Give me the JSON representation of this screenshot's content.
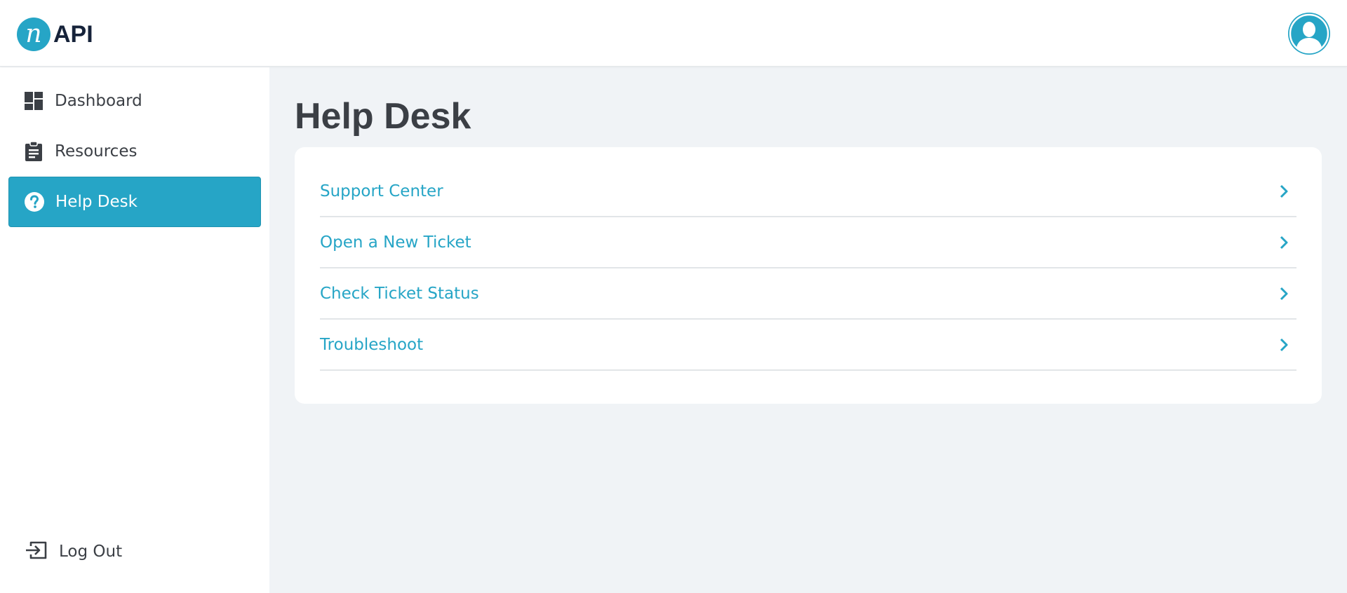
{
  "header": {
    "logo_mark": "n",
    "logo_text": "API",
    "avatar_icon": "user-avatar-icon"
  },
  "sidebar": {
    "items": [
      {
        "label": "Dashboard",
        "icon": "dashboard-icon",
        "active": false
      },
      {
        "label": "Resources",
        "icon": "clipboard-icon",
        "active": false
      },
      {
        "label": "Help Desk",
        "icon": "help-circle-icon",
        "active": true
      }
    ],
    "logout": {
      "label": "Log Out",
      "icon": "logout-icon"
    }
  },
  "main": {
    "title": "Help Desk",
    "links": [
      {
        "label": "Support Center"
      },
      {
        "label": "Open a New Ticket"
      },
      {
        "label": "Check Ticket Status"
      },
      {
        "label": "Troubleshoot"
      }
    ]
  },
  "colors": {
    "accent": "#26a5c6",
    "text": "#3b3f45",
    "background": "#f0f3f6",
    "logo_text": "#16233a"
  }
}
